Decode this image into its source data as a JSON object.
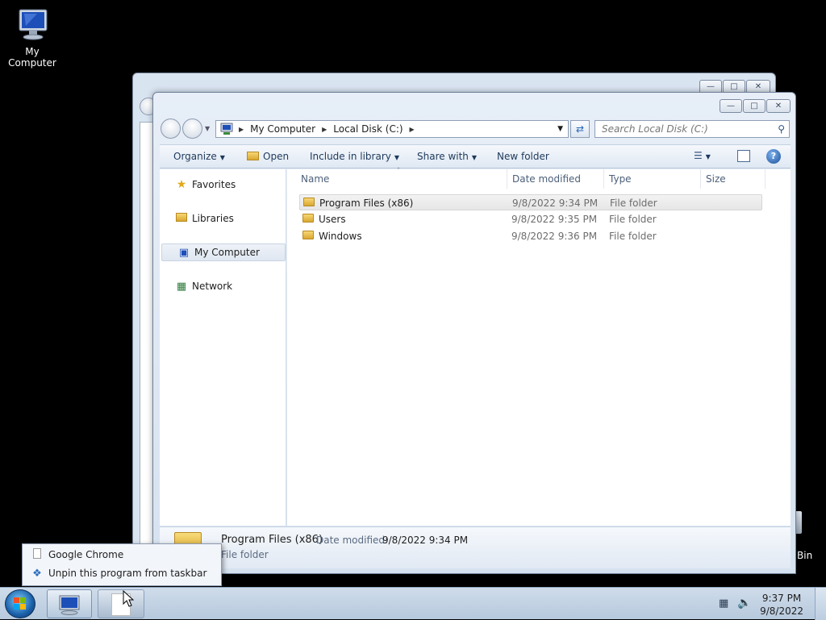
{
  "desktop": {
    "my_computer_label": "My Computer",
    "recycle_label": "Bin"
  },
  "window": {
    "address": {
      "crumbs": [
        "My Computer",
        "Local Disk (C:)"
      ]
    },
    "search_placeholder": "Search Local Disk (C:)",
    "toolbar": {
      "organize": "Organize",
      "open": "Open",
      "include": "Include in library",
      "share": "Share with",
      "new_folder": "New folder"
    },
    "nav": {
      "favorites": "Favorites",
      "libraries": "Libraries",
      "my_computer": "My Computer",
      "network": "Network"
    },
    "columns": {
      "name": "Name",
      "date": "Date modified",
      "type": "Type",
      "size": "Size"
    },
    "files": [
      {
        "name": "Program Files (x86)",
        "date": "9/8/2022 9:34 PM",
        "type": "File folder"
      },
      {
        "name": "Users",
        "date": "9/8/2022 9:35 PM",
        "type": "File folder"
      },
      {
        "name": "Windows",
        "date": "9/8/2022 9:36 PM",
        "type": "File folder"
      }
    ],
    "details": {
      "name": "Program Files (x86)",
      "date_label": "Date modified:",
      "date": "9/8/2022 9:34 PM",
      "type": "File folder"
    }
  },
  "jumplist": {
    "item1": "Google Chrome",
    "item2": "Unpin this program from taskbar"
  },
  "taskbar": {
    "time": "9:37 PM",
    "date": "9/8/2022"
  }
}
